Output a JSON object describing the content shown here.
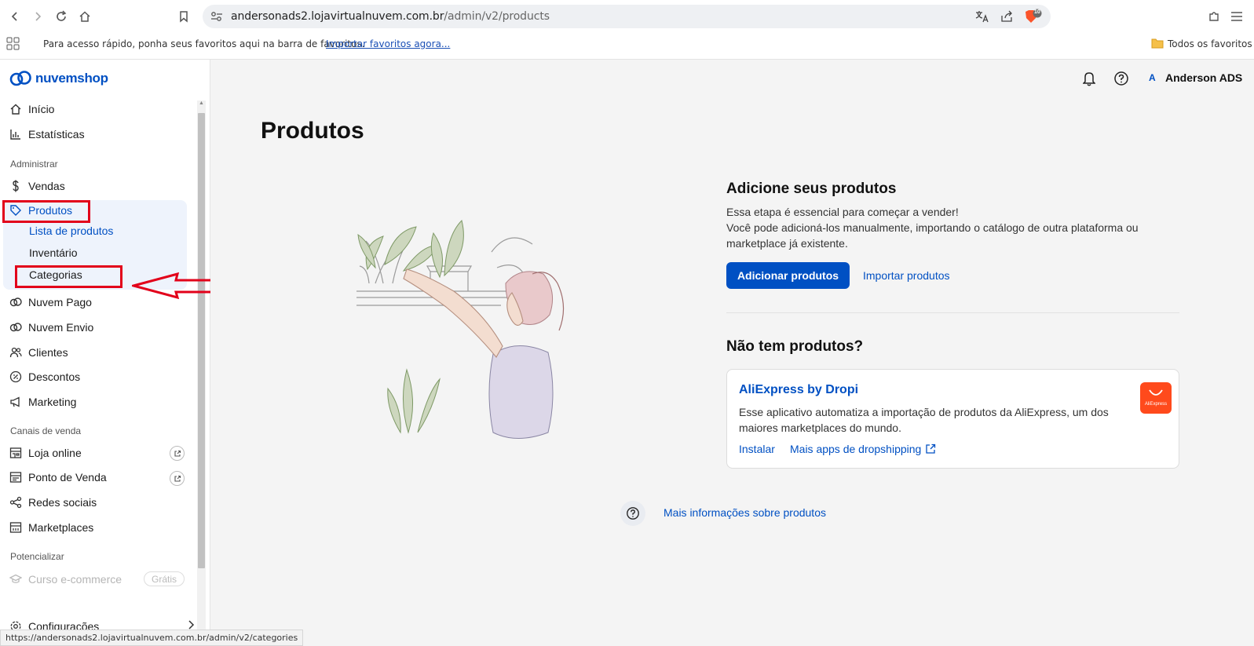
{
  "browser": {
    "url_host": "andersonads2.lojavirtualnuvem.com.br",
    "url_path": "/admin/v2/products",
    "bookmarks_hint": "Para acesso rápido, ponha seus favoritos aqui na barra de favoritos.",
    "bookmarks_import": "Importar favoritos agora...",
    "bookmarks_all": "Todos os favoritos",
    "shield_count": "10",
    "status_url": "https://andersonads2.lojavirtualnuvem.com.br/admin/v2/categories"
  },
  "brand": {
    "name": "nuvemshop",
    "color": "#0050c3"
  },
  "header": {
    "user_initial": "A",
    "user_name": "Anderson ADS"
  },
  "sidebar": {
    "inicio": "Início",
    "estatisticas": "Estatísticas",
    "section_admin": "Administrar",
    "vendas": "Vendas",
    "produtos": "Produtos",
    "lista_produtos": "Lista de produtos",
    "inventario": "Inventário",
    "categorias": "Categorias",
    "nuvem_pago": "Nuvem Pago",
    "nuvem_envio": "Nuvem Envio",
    "clientes": "Clientes",
    "descontos": "Descontos",
    "marketing": "Marketing",
    "section_canais": "Canais de venda",
    "loja_online": "Loja online",
    "ponto_venda": "Ponto de Venda",
    "redes_sociais": "Redes sociais",
    "marketplaces": "Marketplaces",
    "section_potencializar": "Potencializar",
    "curso": "Curso e-commerce",
    "curso_badge": "Grátis",
    "configuracoes": "Configurações"
  },
  "main": {
    "title": "Produtos",
    "add_heading": "Adicione seus produtos",
    "add_line1": "Essa etapa é essencial para começar a vender!",
    "add_line2": "Você pode adicioná-los manualmente, importando o catálogo de outra plataforma ou",
    "add_line3": "marketplace já existente.",
    "add_button": "Adicionar produtos",
    "import_link": "Importar produtos",
    "no_products_heading": "Não tem produtos?",
    "app_title": "AliExpress by Dropi",
    "app_desc1": "Esse aplicativo automatiza a importação de produtos da AliExpress, um dos",
    "app_desc2": "maiores marketplaces do mundo.",
    "app_install": "Instalar",
    "app_more": "Mais apps de dropshipping",
    "app_icon_text": "AliExpress",
    "more_info": "Mais informações sobre produtos"
  },
  "colors": {
    "accent": "#0050c3",
    "annotation": "#e2001a",
    "aliexpress": "#ff4a1c"
  }
}
